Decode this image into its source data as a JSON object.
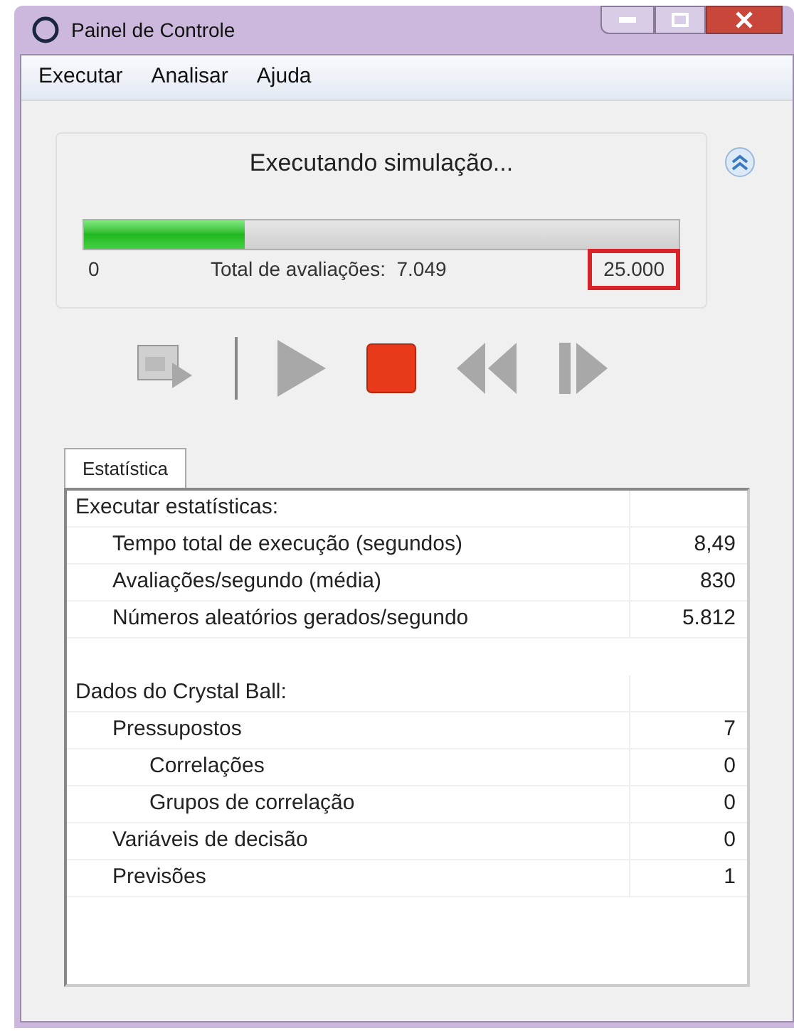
{
  "window": {
    "title": "Painel de Controle"
  },
  "menu": [
    "Executar",
    "Analisar",
    "Ajuda"
  ],
  "progress": {
    "status": "Executando simulação...",
    "level": 0.27,
    "min": "0",
    "total_label": "Total de avaliações:  7.049",
    "max": "25.000",
    "max_highlighted": true
  },
  "tabs": [
    {
      "label": "Estatística",
      "selected": true
    }
  ],
  "stats": [
    {
      "label": "Executar estatísticas:",
      "children": [
        {
          "label": "Tempo total de execução (segundos)",
          "value": "8,49"
        },
        {
          "label": "Avaliações/segundo (média)",
          "value": "830"
        },
        {
          "label": "Números aleatórios gerados/segundo",
          "value": "5.812"
        }
      ]
    },
    {
      "label": "Dados do Crystal Ball:",
      "children": [
        {
          "label": "Pressupostos",
          "value": "7",
          "children": [
            {
              "label": "Correlações",
              "value": "0"
            },
            {
              "label": "Grupos de correlação",
              "value": "0"
            }
          ]
        },
        {
          "label": "Variáveis de decisão",
          "value": "0"
        },
        {
          "label": "Previsões",
          "value": "1"
        }
      ]
    }
  ]
}
